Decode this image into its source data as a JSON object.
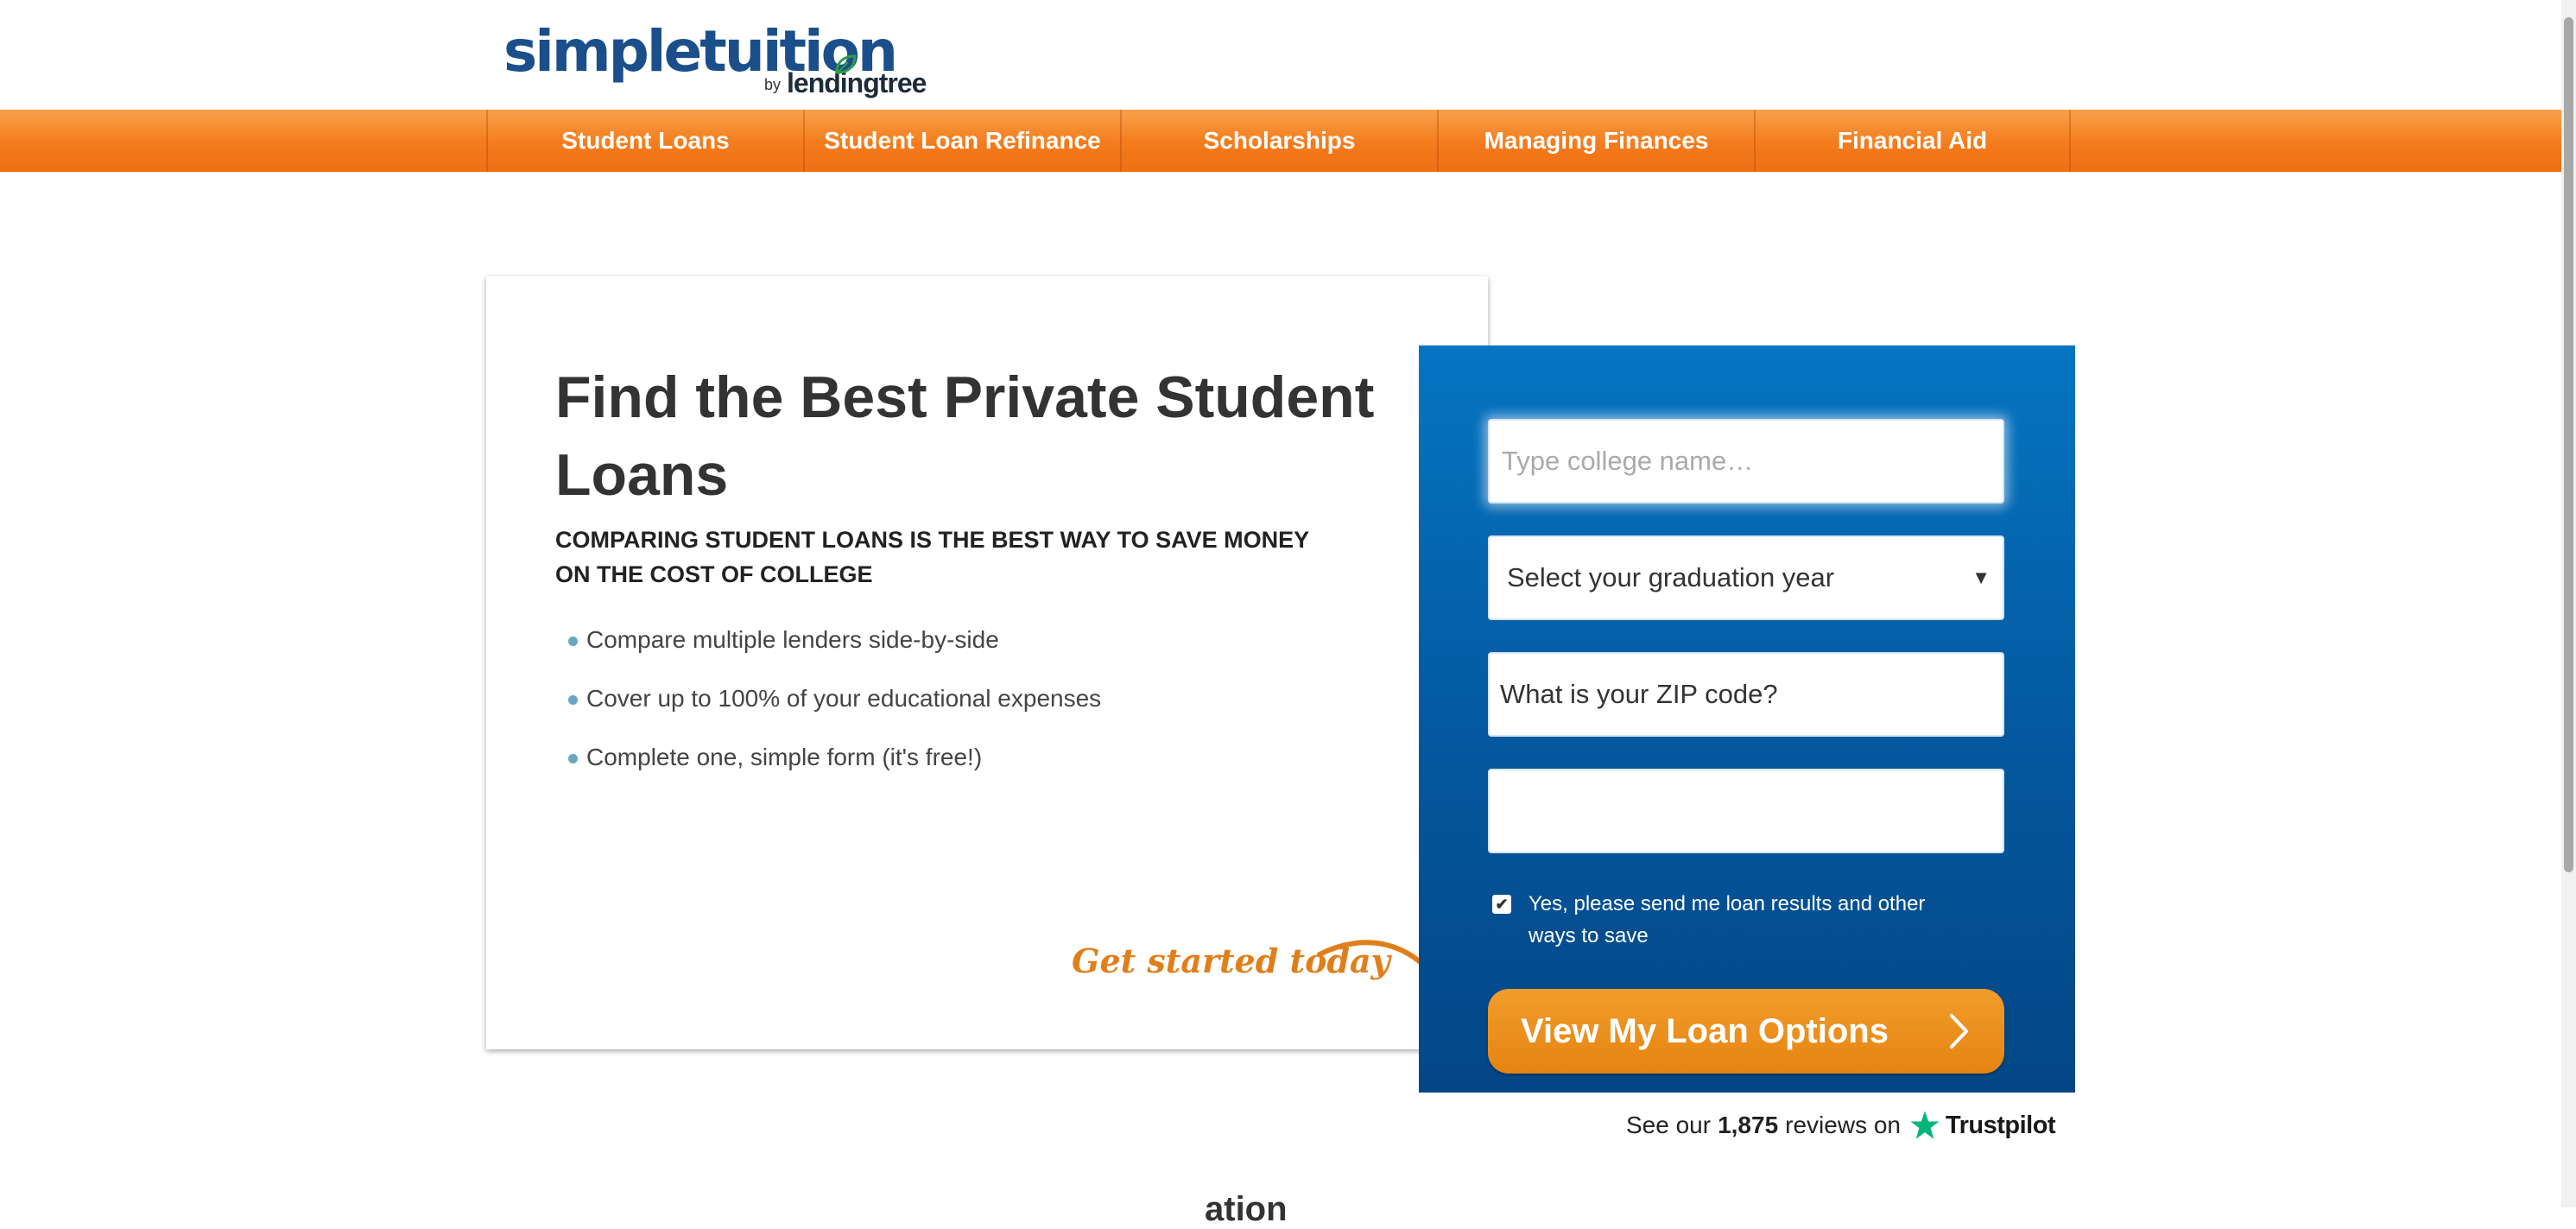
{
  "logo": {
    "main": "simpletuition",
    "by": "by",
    "partner": "lendingtree"
  },
  "nav": {
    "items": [
      {
        "label": "Student Loans"
      },
      {
        "label": "Student Loan Refinance"
      },
      {
        "label": "Scholarships"
      },
      {
        "label": "Managing Finances"
      },
      {
        "label": "Financial Aid"
      }
    ]
  },
  "hero": {
    "title": "Find the Best Private Student Loans",
    "subtitle": "COMPARING STUDENT LOANS IS THE BEST WAY TO SAVE MONEY ON THE COST OF COLLEGE",
    "bullets": [
      "Compare multiple lenders side-by-side",
      "Cover up to 100% of your educational expenses",
      "Complete one, simple form (it's free!)"
    ],
    "get_started": "Get started today"
  },
  "form": {
    "college": {
      "placeholder": "Type college name…",
      "value": ""
    },
    "grad_year": {
      "selected": "Select your graduation year"
    },
    "zip": {
      "value": "What is your ZIP code?"
    },
    "extra": {
      "value": ""
    },
    "consent": {
      "checked": true,
      "text": "Yes, please send me loan results and other ways to save"
    },
    "cta": "View My Loan Options"
  },
  "trustpilot": {
    "prefix": "See our",
    "count": "1,875",
    "suffix": "reviews on",
    "brand": "Trustpilot",
    "star_color": "#00b67a"
  },
  "colors": {
    "nav_orange": "#f47b1c",
    "form_blue": "#04579e",
    "cta_orange": "#e68411",
    "logo_blue": "#1a4f8b",
    "accent_orange_text": "#e07f1a"
  },
  "cutoff_heading": "ation"
}
